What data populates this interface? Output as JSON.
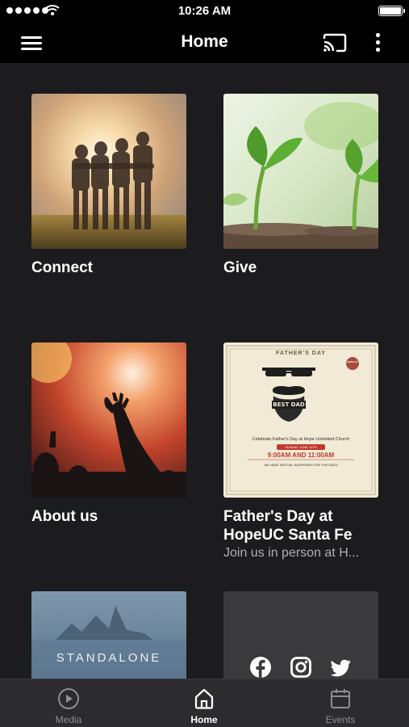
{
  "status_bar": {
    "time": "10:26 AM"
  },
  "nav": {
    "title": "Home"
  },
  "tiles": [
    {
      "title": "Connect"
    },
    {
      "title": "Give"
    },
    {
      "title": "About us"
    },
    {
      "title": "Father's Day at HopeUC Santa Fe",
      "subtitle": "Join us in person at H..."
    },
    {
      "title": "",
      "image_text": "STANDALONE"
    },
    {
      "title": ""
    }
  ],
  "flyer": {
    "heading": "FATHER'S DAY",
    "badge": "HOPE UC",
    "logo_text": "BEST DAD",
    "line1": "Celebrate Father's Day at Hope Unlimited Church",
    "date": "SUNDAY, JUNE 19TH",
    "times": "9:00AM AND 11:00AM",
    "footer": "WE HAVE SPECIAL SURPRISES FOR THE DADS"
  },
  "social_icons": [
    "facebook-icon",
    "instagram-icon",
    "twitter-icon"
  ],
  "tab_bar": {
    "tabs": [
      {
        "label": "Media",
        "icon": "play-circle-icon",
        "active": false
      },
      {
        "label": "Home",
        "icon": "home-icon",
        "active": true
      },
      {
        "label": "Events",
        "icon": "calendar-icon",
        "active": false
      }
    ]
  },
  "colors": {
    "background": "#1c1c1e",
    "bars": "#000000",
    "tab_bar": "#2c2c2e",
    "flyer_red": "#c0392b"
  }
}
